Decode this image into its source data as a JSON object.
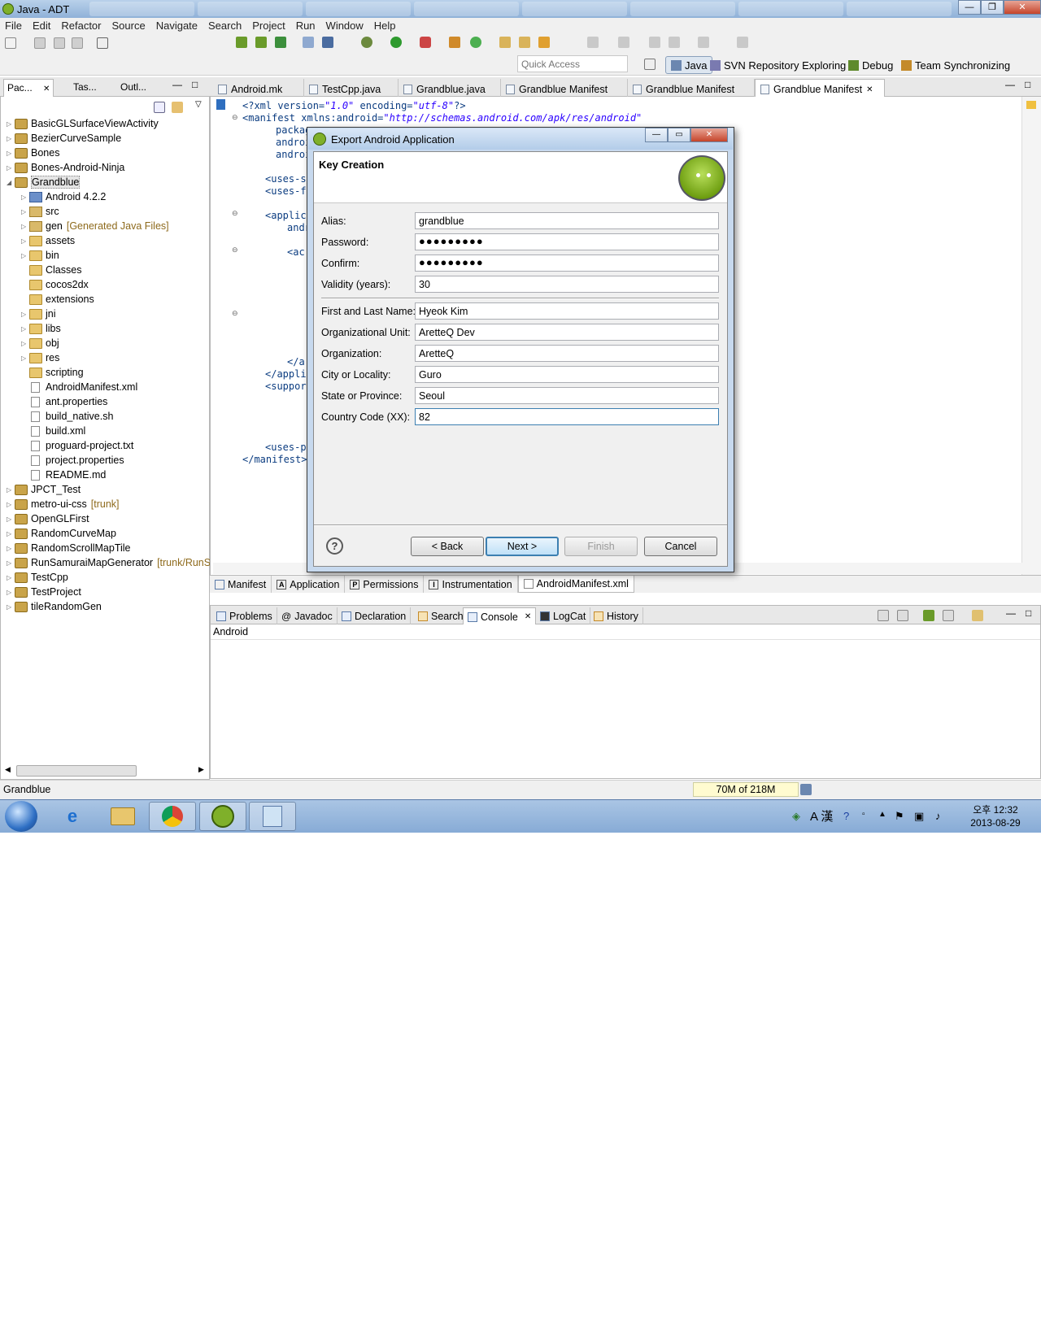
{
  "window": {
    "title": "Java - ADT"
  },
  "menu": [
    "File",
    "Edit",
    "Refactor",
    "Source",
    "Navigate",
    "Search",
    "Project",
    "Run",
    "Window",
    "Help"
  ],
  "quick_access": {
    "placeholder": "Quick Access"
  },
  "perspectives": [
    "Java",
    "SVN Repository Exploring",
    "Debug",
    "Team Synchronizing"
  ],
  "left_tabs": [
    "Pac...",
    "Tas...",
    "Outl..."
  ],
  "tree": [
    {
      "label": "BasicGLSurfaceViewActivity",
      "deco": ""
    },
    {
      "label": "BezierCurveSample",
      "deco": ""
    },
    {
      "label": "Bones",
      "deco": ""
    },
    {
      "label": "Bones-Android-Ninja",
      "deco": ""
    },
    {
      "label": "Grandblue",
      "deco": ""
    },
    {
      "label": "Android 4.2.2",
      "deco": ""
    },
    {
      "label": "src",
      "deco": ""
    },
    {
      "label": "gen",
      "deco": "[Generated Java Files]"
    },
    {
      "label": "assets",
      "deco": ""
    },
    {
      "label": "bin",
      "deco": ""
    },
    {
      "label": "Classes",
      "deco": ""
    },
    {
      "label": "cocos2dx",
      "deco": ""
    },
    {
      "label": "extensions",
      "deco": ""
    },
    {
      "label": "jni",
      "deco": ""
    },
    {
      "label": "libs",
      "deco": ""
    },
    {
      "label": "obj",
      "deco": ""
    },
    {
      "label": "res",
      "deco": ""
    },
    {
      "label": "scripting",
      "deco": ""
    },
    {
      "label": "AndroidManifest.xml",
      "deco": ""
    },
    {
      "label": "ant.properties",
      "deco": ""
    },
    {
      "label": "build_native.sh",
      "deco": ""
    },
    {
      "label": "build.xml",
      "deco": ""
    },
    {
      "label": "proguard-project.txt",
      "deco": ""
    },
    {
      "label": "project.properties",
      "deco": ""
    },
    {
      "label": "README.md",
      "deco": ""
    },
    {
      "label": "JPCT_Test",
      "deco": ""
    },
    {
      "label": "metro-ui-css",
      "deco": "[trunk]"
    },
    {
      "label": "OpenGLFirst",
      "deco": ""
    },
    {
      "label": "RandomCurveMap",
      "deco": ""
    },
    {
      "label": "RandomScrollMapTile",
      "deco": ""
    },
    {
      "label": "RunSamuraiMapGenerator",
      "deco": "[trunk/RunS"
    },
    {
      "label": "TestCpp",
      "deco": ""
    },
    {
      "label": "TestProject",
      "deco": ""
    },
    {
      "label": "tileRandomGen",
      "deco": ""
    }
  ],
  "editor_tabs": [
    "Android.mk",
    "TestCpp.java",
    "Grandblue.java",
    "Grandblue Manifest",
    "Grandblue Manifest",
    "Grandblue Manifest"
  ],
  "code": {
    "l1_a": "<?xml version=",
    "l1_b": "\"1.0\"",
    "l1_c": " encoding=",
    "l1_d": "\"utf-8\"",
    "l1_e": "?>",
    "l2_a": "<manifest xmlns:android=",
    "l2_b": "\"http://schemas.android.com/apk/res/android\"",
    "l3": "packag",
    "l4": "androi",
    "l5": "androi",
    "l6": "<uses-s",
    "l7": "<uses-f",
    "l8": "<applic",
    "l9": "andr",
    "l10": "<ac",
    "l11": "</a",
    "l12": "</appli",
    "l13": "<suppor",
    "l14": "<uses-p",
    "l15": "</manifest>"
  },
  "form_tabs": [
    "Manifest",
    "Application",
    "Permissions",
    "Instrumentation",
    "AndroidManifest.xml"
  ],
  "console_tabs": [
    "Problems",
    "Javadoc",
    "Declaration",
    "Search",
    "Console",
    "LogCat",
    "History"
  ],
  "console": {
    "header": "Android"
  },
  "status": {
    "selection": "Grandblue",
    "heap": "70M of 218M"
  },
  "taskbar": {
    "time": "오후 12:32",
    "date": "2013-08-29",
    "ime": "A 漢"
  },
  "dialog": {
    "title": "Export Android Application",
    "heading": "Key Creation",
    "fields": [
      {
        "label": "Alias:",
        "value": "grandblue"
      },
      {
        "label": "Password:",
        "value": "●●●●●●●●●"
      },
      {
        "label": "Confirm:",
        "value": "●●●●●●●●●"
      },
      {
        "label": "Validity (years):",
        "value": "30"
      },
      {
        "label": "First and Last Name:",
        "value": "Hyeok Kim"
      },
      {
        "label": "Organizational Unit:",
        "value": "AretteQ Dev"
      },
      {
        "label": "Organization:",
        "value": "AretteQ"
      },
      {
        "label": "City or Locality:",
        "value": "Guro"
      },
      {
        "label": "State or Province:",
        "value": "Seoul"
      },
      {
        "label": "Country Code (XX):",
        "value": "82"
      }
    ],
    "buttons": {
      "help": "?",
      "back": "< Back",
      "next": "Next >",
      "finish": "Finish",
      "cancel": "Cancel"
    }
  }
}
